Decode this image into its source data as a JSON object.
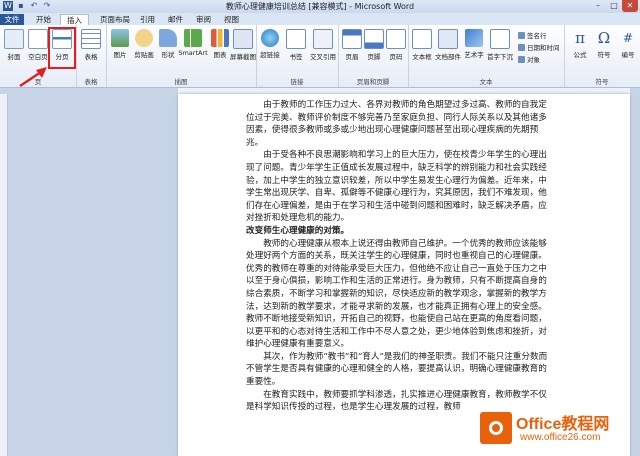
{
  "window": {
    "title": "教师心理健康培训总结 [兼容模式] - Microsoft Word",
    "controls": [
      "–",
      "□",
      "✕"
    ]
  },
  "tabs": [
    "文件",
    "开始",
    "插入",
    "页面布局",
    "引用",
    "邮件",
    "审阅",
    "视图"
  ],
  "ribbon": {
    "pages": {
      "label": "页",
      "cover": "封面",
      "blank": "空白页",
      "break": "分页"
    },
    "table": {
      "label": "表格",
      "table": "表格"
    },
    "illustrations": {
      "label": "插图",
      "picture": "图片",
      "clipart": "剪贴画",
      "shapes": "形状",
      "smartart": "SmartArt",
      "chart": "图表",
      "screenshot": "屏幕截图"
    },
    "links": {
      "label": "链接",
      "hyperlink": "超链接",
      "bookmark": "书签",
      "crossref": "交叉引用"
    },
    "header_footer": {
      "label": "页眉和页脚",
      "header": "页眉",
      "footer": "页脚",
      "page_number": "页码"
    },
    "text": {
      "label": "文本",
      "textbox": "文本框",
      "quickparts": "文档部件",
      "wordart": "艺术字",
      "dropcap": "首字下沉",
      "signature": "签名行",
      "datetime": "日期和时间",
      "object": "对象"
    },
    "symbols": {
      "label": "符号",
      "equation": "公式",
      "symbol": "符号",
      "number": "编号"
    }
  },
  "document": {
    "paragraphs": [
      "由于教师的工作压力过大、各界对教师的角色期望过多过高、教师的自我定位过于完美、教师评价制度不够完善乃至家庭负担、同行人际关系以及其他诸多因素，使得很多教师或多或少地出现心理健康问题甚至出现心理疾病的先期预兆。",
      "由于受各种不良思潮影响和学习上的巨大压力，使在校青少年学生的心理出现了问题。青少年学生正值成长发展过程中，缺乏科学的辨别能力和社会实践经验，加上中学生的独立意识较差，所以中学生易发生心理行为偏差。近年来，中学生常出现厌学、自卑、孤僻等不健康心理行为，究其原因，我们不难发现，他们存在心理偏差，是由于在学习和生活中碰到问题和困难时，缺乏解决矛盾，应对挫折和处理危机的能力。"
    ],
    "heading": "改变师生心理健康的对策。",
    "paragraphs2": [
      "教师的心理健康从根本上说还得由教师自己维护。一个优秀的教师应该能够处理好两个方面的关系，既关注学生的心理健康，同时也重视自己的心理健康。优秀的教师在尊重的对待能承受巨大压力，但他绝不应让自己一直处于压力之中以至于身心俱损，影响工作和生活的正常进行。身为教师，只有不断提高自身的综合素质，不断学习和掌握新的知识，尽快适应新的教学观念，掌握新的教学方法，达到新的教学要求，才能寻求新的发展，也才能真正拥有心理上的安全感。教师不断地接受新知识，开拓自己的视野，也能使自己站在更高的角度看问题，以更平和的心态对待生活和工作中不尽人意之处，更少地体验到焦虑和挫折，对维护心理健康有重要意义。",
      "其次，作为教师“教书”和“育人”是我们的神圣职责。我们不能只注重分数而不管学生是否具有健康的心理和健全的人格，要提高认识，明确心理健康教育的重要性。",
      "在教育实践中，教师要抓学科渗透，扎实推进心理健康教育，教师教学不仅是科学知识传授的过程，也是学生心理发展的过程，教师"
    ]
  },
  "watermark": {
    "line1": "Office教程网",
    "line2": "www.office26.com"
  },
  "colors": {
    "file_tab": "#2b579a",
    "highlight": "#e02020",
    "accent": "#e8620c"
  }
}
